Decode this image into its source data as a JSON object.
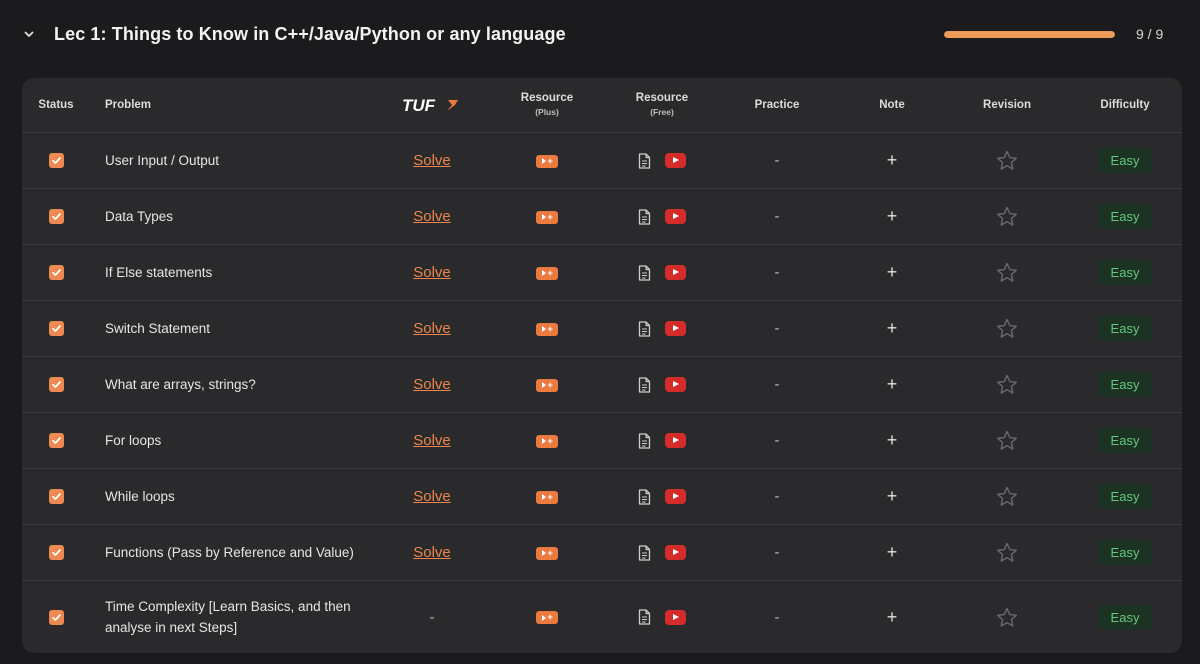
{
  "section": {
    "title": "Lec 1: Things to Know in C++/Java/Python or any language",
    "count": "9 / 9",
    "progress_fraction": 1.0
  },
  "colors": {
    "accent": "#ec9a56",
    "checkbox": "#ee8a51",
    "youtube": "#d52b2b",
    "easy_text": "#63c97c"
  },
  "table": {
    "headers": {
      "status": "Status",
      "problem": "Problem",
      "tuf_logo": "TUF",
      "resource": "Resource",
      "plus": "(Plus)",
      "resource2": "Resource",
      "free": "(Free)",
      "practice": "Practice",
      "note": "Note",
      "revision": "Revision",
      "difficulty": "Difficulty"
    },
    "rows": [
      {
        "problem": "User Input / Output",
        "tuf": "Solve",
        "practice": "-",
        "difficulty": "Easy"
      },
      {
        "problem": "Data Types",
        "tuf": "Solve",
        "practice": "-",
        "difficulty": "Easy"
      },
      {
        "problem": "If Else statements",
        "tuf": "Solve",
        "practice": "-",
        "difficulty": "Easy"
      },
      {
        "problem": "Switch Statement",
        "tuf": "Solve",
        "practice": "-",
        "difficulty": "Easy"
      },
      {
        "problem": "What are arrays, strings?",
        "tuf": "Solve",
        "practice": "-",
        "difficulty": "Easy"
      },
      {
        "problem": "For loops",
        "tuf": "Solve",
        "practice": "-",
        "difficulty": "Easy"
      },
      {
        "problem": "While loops",
        "tuf": "Solve",
        "practice": "-",
        "difficulty": "Easy"
      },
      {
        "problem": "Functions (Pass by Reference and Value)",
        "tuf": "Solve",
        "practice": "-",
        "difficulty": "Easy"
      },
      {
        "problem": "Time Complexity [Learn Basics, and then analyse in next Steps]",
        "tuf": "-",
        "practice": "-",
        "difficulty": "Easy"
      }
    ]
  },
  "icons": {
    "collapse": "chevron-down-icon",
    "status": "checkbox-checked-icon",
    "plus_resource": "play-plus-icon",
    "article": "document-icon",
    "video": "youtube-icon",
    "note": "plus-icon",
    "revision": "star-icon"
  }
}
